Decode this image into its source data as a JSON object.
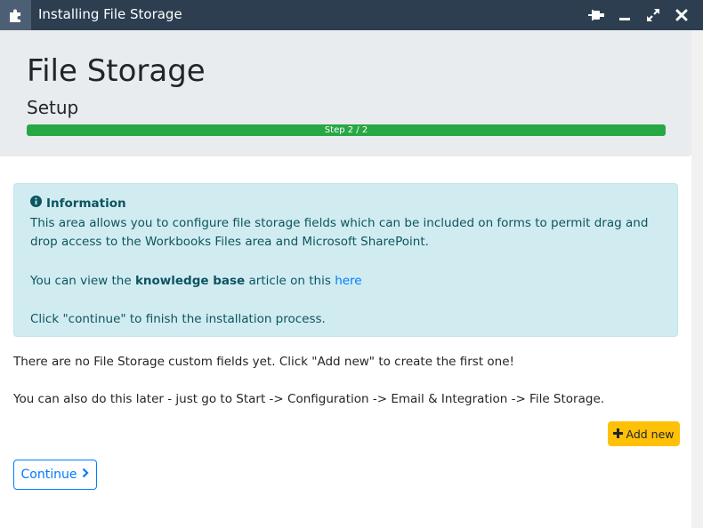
{
  "window": {
    "title": "Installing File Storage",
    "icons": {
      "app": "puzzle-icon",
      "pin": "pin-icon",
      "minimize": "minimize-icon",
      "maximize": "maximize-icon",
      "close": "close-icon"
    }
  },
  "header": {
    "title": "File Storage",
    "subtitle": "Setup",
    "progress": {
      "label": "Step 2 / 2",
      "percent": 100,
      "color": "#28a745"
    }
  },
  "info": {
    "heading": "Information",
    "icon": "info-circle-icon",
    "line1": "This area allows you to configure file storage fields which can be included on forms to permit drag and drop access to the Workbooks Files area and Microsoft SharePoint.",
    "kb_prefix": "You can view the ",
    "kb_bold": "knowledge base",
    "kb_middle": " article on this ",
    "kb_link": "here",
    "line3": "Click \"continue\" to finish the installation process."
  },
  "main": {
    "no_fields_text": "There are no File Storage custom fields yet. Click \"Add new\" to create the first one!",
    "later_text": "You can also do this later - just go to Start -> Configuration -> Email & Integration -> File Storage."
  },
  "buttons": {
    "add_new": "Add new",
    "add_icon": "plus-icon",
    "continue": "Continue",
    "continue_icon": "chevron-right-icon"
  },
  "colors": {
    "titlebar": "#2c3e50",
    "info_bg": "#d1ecf1",
    "info_text": "#0c5460",
    "add_button": "#ffc107",
    "primary": "#007bff"
  }
}
